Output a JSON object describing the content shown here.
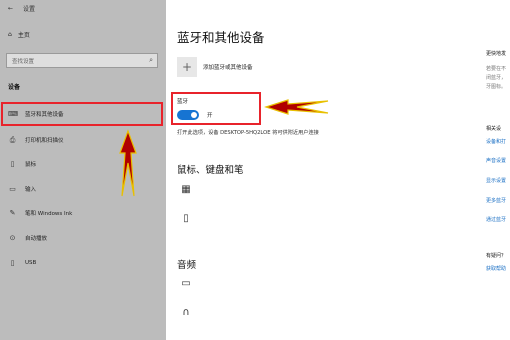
{
  "window": {
    "back_glyph": "←",
    "title": "设置"
  },
  "sidebar": {
    "home_label": "主页",
    "search_placeholder": "查找设置",
    "section_label": "设备",
    "items": [
      {
        "label": "蓝牙和其他设备",
        "icon": "bluetooth-devices-icon"
      },
      {
        "label": "打印机和扫描仪",
        "icon": "printer-icon"
      },
      {
        "label": "鼠标",
        "icon": "mouse-icon"
      },
      {
        "label": "输入",
        "icon": "keyboard-icon"
      },
      {
        "label": "笔和 Windows Ink",
        "icon": "pen-icon"
      },
      {
        "label": "自动播放",
        "icon": "autoplay-icon"
      },
      {
        "label": "USB",
        "icon": "usb-icon"
      }
    ],
    "selected_index": 0
  },
  "main": {
    "page_title": "蓝牙和其他设备",
    "add_device_label": "添加蓝牙或其他设备",
    "bluetooth": {
      "label": "蓝牙",
      "state": "开",
      "on": true,
      "discover_text": "打开此选项，设备 DESKTOP-5HQ2LOE 将可供附近用户连接"
    },
    "section_mkp": "鼠标、键盘和笔",
    "section_audio": "音频"
  },
  "right_column": {
    "quick_title": "更快地发",
    "quick_desc": [
      "若要在不",
      "闭蓝牙，",
      "牙图标。"
    ],
    "related_title": "相关设",
    "related_links": [
      "设备和打",
      "声音设置",
      "显示设置",
      "更多蓝牙",
      "通过蓝牙"
    ],
    "question_title": "有疑问？",
    "question_link": "获取帮助"
  },
  "colors": {
    "sidebar_bg": "#bcbcbc",
    "accent": "#1674d2",
    "annotation_red": "#e8232b",
    "arrow_fill": "#b00000",
    "link": "#1a6fc4"
  }
}
